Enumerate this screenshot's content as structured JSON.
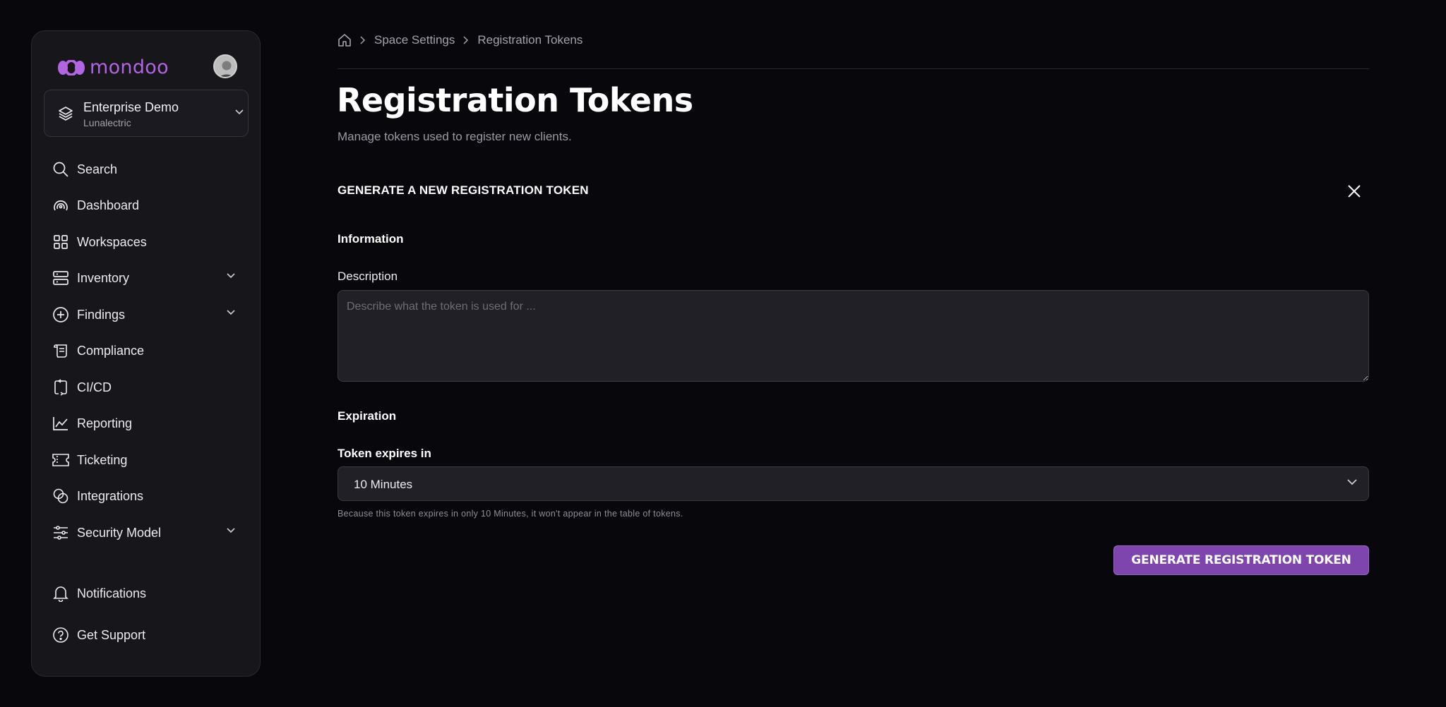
{
  "brand": {
    "name": "mondoo",
    "accent": "#b265e0",
    "button_color": "#7d45ad"
  },
  "space": {
    "name": "Enterprise Demo",
    "org": "Lunalectric"
  },
  "nav": {
    "items": [
      {
        "label": "Search",
        "icon": "search-icon"
      },
      {
        "label": "Dashboard",
        "icon": "dashboard-icon"
      },
      {
        "label": "Workspaces",
        "icon": "grid-icon"
      },
      {
        "label": "Inventory",
        "icon": "server-icon",
        "expandable": true
      },
      {
        "label": "Findings",
        "icon": "plus-circle-icon",
        "expandable": true
      },
      {
        "label": "Compliance",
        "icon": "scroll-icon"
      },
      {
        "label": "CI/CD",
        "icon": "cicd-icon"
      },
      {
        "label": "Reporting",
        "icon": "chart-line-icon"
      },
      {
        "label": "Ticketing",
        "icon": "ticket-icon"
      },
      {
        "label": "Integrations",
        "icon": "integrations-icon"
      },
      {
        "label": "Security Model",
        "icon": "sliders-icon",
        "expandable": true
      }
    ],
    "bottom": [
      {
        "label": "Notifications",
        "icon": "bell-icon"
      },
      {
        "label": "Get Support",
        "icon": "help-circle-icon"
      }
    ]
  },
  "breadcrumb": {
    "items": [
      "Space Settings",
      "Registration Tokens"
    ]
  },
  "page": {
    "title": "Registration Tokens",
    "subtitle": "Manage tokens used to register new clients."
  },
  "form": {
    "heading": "GENERATE A NEW REGISTRATION TOKEN",
    "information_heading": "Information",
    "description_label": "Description",
    "description_placeholder": "Describe what the token is used for ...",
    "description_value": "",
    "expiration_heading": "Expiration",
    "expires_label": "Token expires in",
    "expires_value": "10 Minutes",
    "helper_text": "Because this token expires in only 10 Minutes, it won't appear in the table of tokens.",
    "submit_label": "GENERATE REGISTRATION TOKEN"
  }
}
